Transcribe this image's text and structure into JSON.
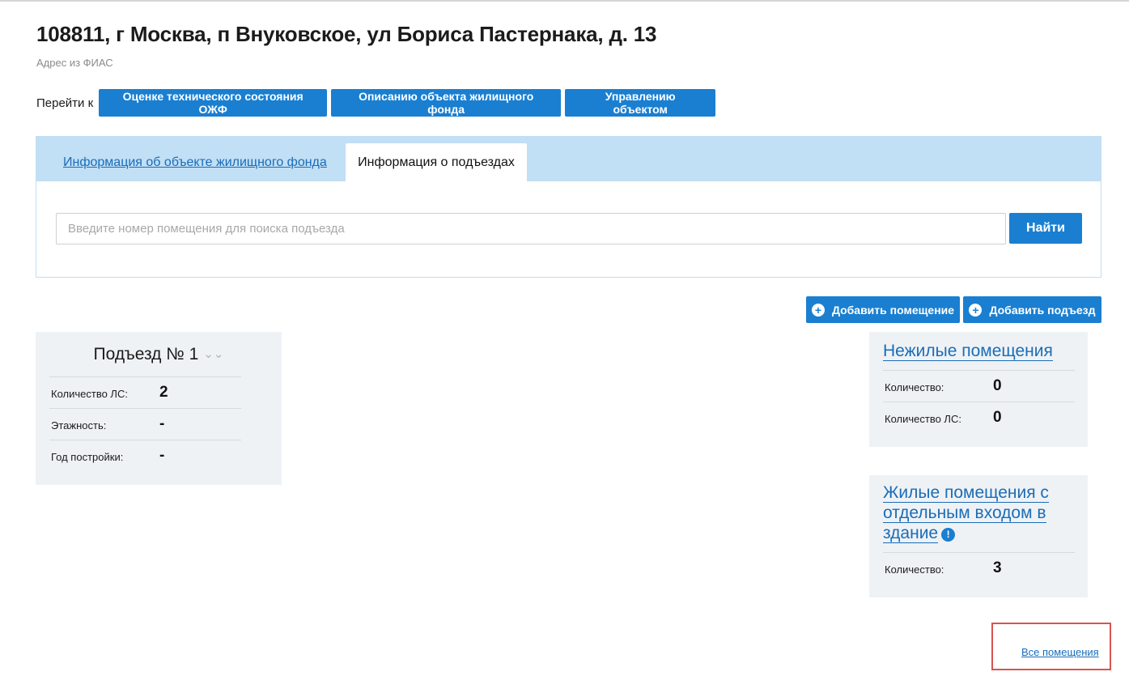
{
  "header": {
    "address": "108811, г Москва, п Внуковское, ул Бориса Пастернака, д. 13",
    "address_source": "Адрес из ФИАС"
  },
  "goto": {
    "label": "Перейти к",
    "buttons": [
      "Оценке технического состояния ОЖФ",
      "Описанию объекта жилищного фонда",
      "Управлению объектом"
    ]
  },
  "tabs": [
    {
      "label": "Информация об объекте жилищного фонда",
      "active": false
    },
    {
      "label": "Информация о подъездах",
      "active": true
    }
  ],
  "search": {
    "placeholder": "Введите номер помещения для поиска подъезда",
    "value": "",
    "button": "Найти"
  },
  "actions": {
    "add_room": "Добавить помещение",
    "add_entrance": "Добавить подъезд"
  },
  "entrance": {
    "title": "Подъезд № 1",
    "rows": [
      {
        "label": "Количество ЛС:",
        "value": "2"
      },
      {
        "label": "Этажность:",
        "value": "-"
      },
      {
        "label": "Год постройки:",
        "value": "-"
      }
    ]
  },
  "nonresidential": {
    "title": "Нежилые помещения",
    "rows": [
      {
        "label": "Количество:",
        "value": "0"
      },
      {
        "label": "Количество ЛС:",
        "value": "0"
      }
    ]
  },
  "residential_separate": {
    "title_lines": [
      "Жилые помещения с",
      "отдельным входом в",
      "здание"
    ],
    "rows": [
      {
        "label": "Количество:",
        "value": "3"
      }
    ]
  },
  "all_rooms_link": "Все помещения",
  "colors": {
    "accent": "#1a7fd1",
    "link": "#1a6db8",
    "tab_bar": "#c1dff5",
    "card_bg": "#eff2f5",
    "highlight": "#d9534f"
  },
  "icons": {
    "add": "plus-circle-icon",
    "expand": "double-chevron-down-icon",
    "info": "exclamation-circle-icon"
  }
}
